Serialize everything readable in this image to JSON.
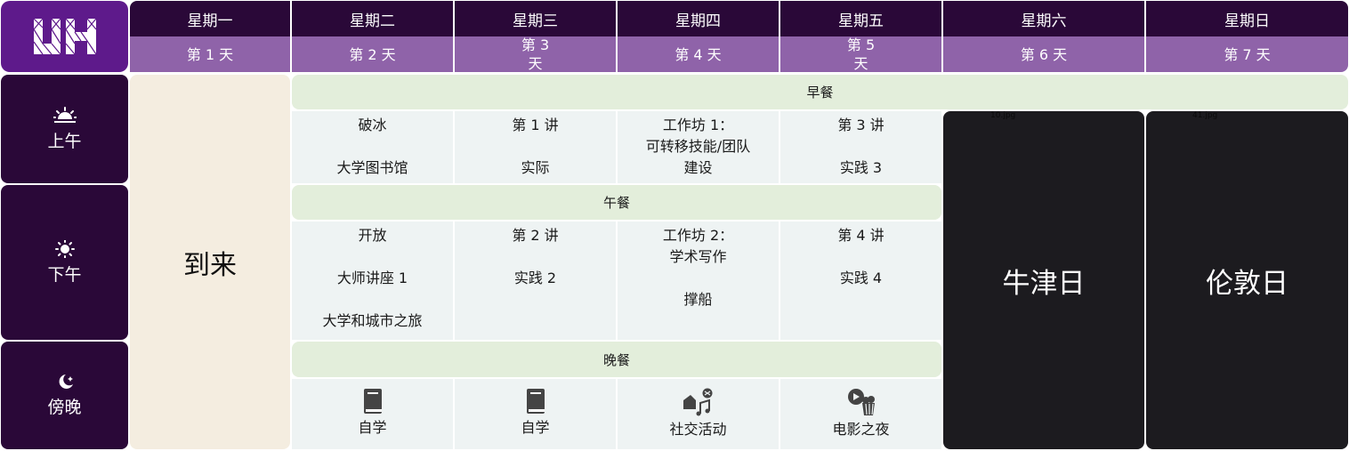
{
  "logo": {
    "text": "UH"
  },
  "days": [
    {
      "name": "星期一",
      "num": "第 1 天"
    },
    {
      "name": "星期二",
      "num": "第 2 天"
    },
    {
      "name": "星期三",
      "num": "第 3\n天"
    },
    {
      "name": "星期四",
      "num": "第 4 天"
    },
    {
      "name": "星期五",
      "num": "第 5\n天"
    },
    {
      "name": "星期六",
      "num": "第 6 天"
    },
    {
      "name": "星期日",
      "num": "第 7 天"
    }
  ],
  "periods": {
    "morning": {
      "label": "上午",
      "icon": "sunrise-icon"
    },
    "afternoon": {
      "label": "下午",
      "icon": "sun-icon"
    },
    "evening": {
      "label": "傍晚",
      "icon": "moon-icon"
    }
  },
  "arrival": "到来",
  "meals": {
    "breakfast": "早餐",
    "lunch": "午餐",
    "dinner": "晚餐"
  },
  "morning": [
    {
      "lines": "破冰\n\n大学图书馆"
    },
    {
      "lines": "第 1 讲\n\n实际"
    },
    {
      "lines": "工作坊 1：\n可转移技能/团队\n建设"
    },
    {
      "lines": "第 3 讲\n\n实践 3"
    }
  ],
  "afternoon": [
    {
      "lines": "开放\n\n大师讲座 1\n\n大学和城市之旅"
    },
    {
      "lines": "第 2 讲\n\n实践 2"
    },
    {
      "lines": "工作坊 2：\n学术写作\n\n撑船"
    },
    {
      "lines": "第 4 讲\n\n实践 4"
    }
  ],
  "evening": [
    {
      "label": "自学",
      "icon": "book-icon"
    },
    {
      "label": "自学",
      "icon": "book-icon"
    },
    {
      "label": "社交活动",
      "icon": "social-media-icon"
    },
    {
      "label": "电影之夜",
      "icon": "movie-popcorn-icon"
    }
  ],
  "excursions": {
    "saturday": {
      "title": "牛津日",
      "caption": "10.jpg"
    },
    "sunday": {
      "title": "伦敦日",
      "caption": "41.jpg"
    }
  },
  "colors": {
    "header_dark": "#2a0838",
    "header_light": "#8f63a9",
    "logo_bg": "#5e1a8b",
    "meal_bg": "#e3eedb",
    "cell_bg": "#eef3f3",
    "arrival_bg": "#f4ede0",
    "excursion_bg": "#1c1b1f"
  }
}
